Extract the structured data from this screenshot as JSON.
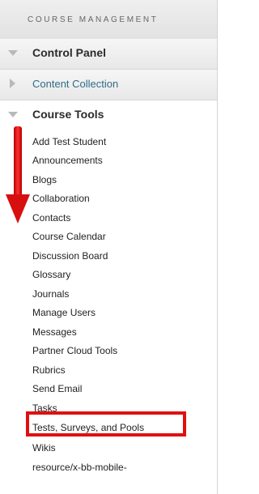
{
  "section": {
    "title": "COURSE MANAGEMENT"
  },
  "groups": [
    {
      "label": "Control Panel"
    },
    {
      "label": "Content Collection"
    },
    {
      "label": "Course Tools"
    }
  ],
  "tools": [
    "Add Test Student",
    "Announcements",
    "Blogs",
    "Collaboration",
    "Contacts",
    "Course Calendar",
    "Discussion Board",
    "Glossary",
    "Journals",
    "Manage Users",
    "Messages",
    "Partner Cloud Tools",
    "Rubrics",
    "Send Email",
    "Tasks",
    "Tests, Surveys, and Pools",
    "Wikis",
    "resource/x-bb-mobile-"
  ],
  "colors": {
    "highlight": "#e01010",
    "link": "#2e6d88"
  },
  "icons": {
    "expanded": "triangle-down-icon",
    "collapsed": "triangle-right-icon",
    "annotation": "down-arrow-icon"
  }
}
